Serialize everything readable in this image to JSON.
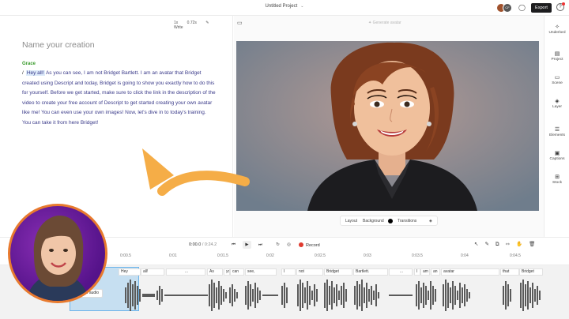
{
  "topbar": {
    "project_title": "Untitled Project",
    "export_label": "Export",
    "help_label": "?",
    "collaborator_initial": "CF"
  },
  "script": {
    "toolbar_speed": "1x",
    "toolbar_duration": "0.72s",
    "toolbar_write": "Write",
    "title_placeholder": "Name your creation",
    "speaker": "Grace",
    "pre_highlight": "/",
    "highlight": "Hey all!",
    "body": " As you can see, I am not Bridget Bartlett. I am an avatar that Bridget created using Descript and today, Bridget is going to show you exactly how to do this for yourself. Before we get started, make sure to click the link in the description of the video to create your free account of Descript to get started creating your own avatar like me! You can even use your own images! Now, let's dive in to today's training. You can take it from here Bridget!"
  },
  "canvas": {
    "generate_label": "Generate avatar",
    "layout_label": "Layout",
    "background_label": "Background",
    "transitions_label": "Transitions"
  },
  "sidebar": {
    "items": [
      {
        "label": "Underlord",
        "icon": "underlord-icon"
      },
      {
        "label": "Project",
        "icon": "project-icon"
      },
      {
        "label": "Scene",
        "icon": "scene-icon"
      },
      {
        "label": "Layer",
        "icon": "layer-icon"
      },
      {
        "label": "Elements",
        "icon": "elements-icon"
      },
      {
        "label": "Captions",
        "icon": "captions-icon"
      },
      {
        "label": "Stock",
        "icon": "stock-icon"
      }
    ]
  },
  "transport": {
    "time_current": "0:00.0",
    "time_total": " / 0:24.2",
    "record_label": "Record"
  },
  "ruler": {
    "ticks": [
      "0:00.5",
      "0:01",
      "0:01.5",
      "0:02",
      "0:02.5",
      "0:03",
      "0:03.5",
      "0:04",
      "0:04.5"
    ]
  },
  "timeline": {
    "words": [
      "Hey",
      "all!",
      "...",
      "As",
      "you",
      "can",
      "see,",
      "I",
      "not",
      "Bridget",
      "Bartlett.",
      "...",
      "I",
      "am",
      "an",
      "avatar",
      "that",
      "Bridget"
    ],
    "tooltip": "Add to audio"
  },
  "colors": {
    "accent_orange": "#e87a2e",
    "speaker_green": "#3a9b2c",
    "script_text": "#3b3b8a",
    "selection_blue": "#6cb4ea",
    "record_red": "#e03b2f"
  }
}
